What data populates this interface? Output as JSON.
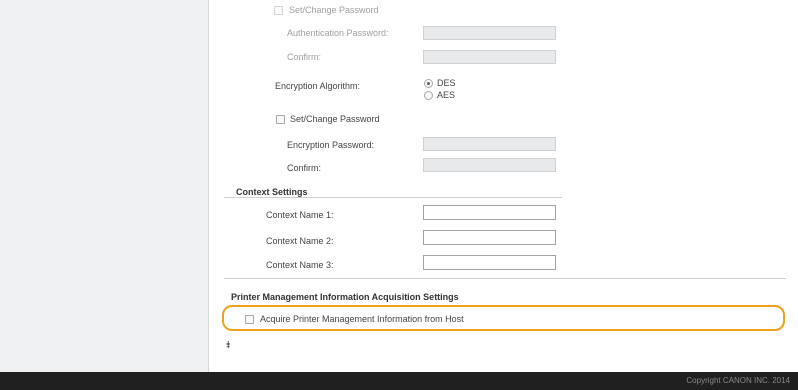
{
  "snmpv3": {
    "auth_change_password_label": "Set/Change Password",
    "auth_password_label": "Authentication Password:",
    "auth_confirm_label": "Confirm:",
    "encryption_algorithm_label": "Encryption Algorithm:",
    "encryption_options": [
      "DES",
      "AES"
    ],
    "encryption_selected": "DES",
    "enc_change_password_label": "Set/Change Password",
    "enc_password_label": "Encryption Password:",
    "enc_confirm_label": "Confirm:"
  },
  "context_settings": {
    "heading": "Context Settings",
    "fields": [
      {
        "label": "Context Name 1:",
        "value": ""
      },
      {
        "label": "Context Name 2:",
        "value": ""
      },
      {
        "label": "Context Name 3:",
        "value": ""
      }
    ]
  },
  "printer_mgmt": {
    "heading": "Printer Management Information Acquisition Settings",
    "checkbox_label": "Acquire Printer Management Information from Host",
    "checked": false
  },
  "scroll_top_glyph": "⯒",
  "footer": {
    "copyright": "Copyright CANON INC. 2014"
  },
  "colors": {
    "highlight": "#f0a020",
    "footer_bg": "#202020",
    "sidebar_bg": "#eef0f2"
  }
}
